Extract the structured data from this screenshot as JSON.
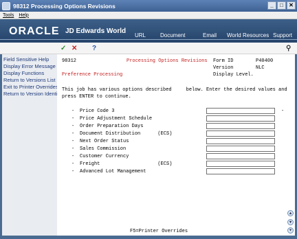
{
  "window": {
    "title": "98312    Processing Options Revisions"
  },
  "menu": {
    "items": [
      "Tools",
      "Help"
    ]
  },
  "banner": {
    "logo": "ORACLE",
    "product": "JD Edwards World",
    "links": [
      "URL",
      "Document",
      "Email",
      "World Resources",
      "Support"
    ]
  },
  "toolbar": {
    "ok": "✓",
    "cancel": "✕",
    "help": "?",
    "search": "⚲"
  },
  "sidebar": {
    "items": [
      "Field Sensitive Help",
      "Display Error Message",
      "Display Functions",
      "Return to Versions List",
      "Exit to Printer Overrides",
      "Return to Version Identi"
    ]
  },
  "form": {
    "program": "98312",
    "title": "Processing Options Revisions",
    "form_id_label": "Form ID",
    "form_id": "P40400",
    "version_label": "Version",
    "version": "NLC",
    "display_level": "Display Level.",
    "subtitle": "Preference Processing",
    "instructions_1": "This job has various options described     below. Enter the desired values and",
    "instructions_2": "press ENTER to continue.",
    "options": [
      "Price Code 3",
      "Price Adjustment Schedule",
      "Order Preparation Days",
      "Document Distribution      (ECS)",
      "Next Order Status",
      "Sales Commission",
      "Customer Currency",
      "Freight                    (ECS)",
      "Advanced Lot Management"
    ],
    "footer": "F5=Printer Overrides"
  }
}
